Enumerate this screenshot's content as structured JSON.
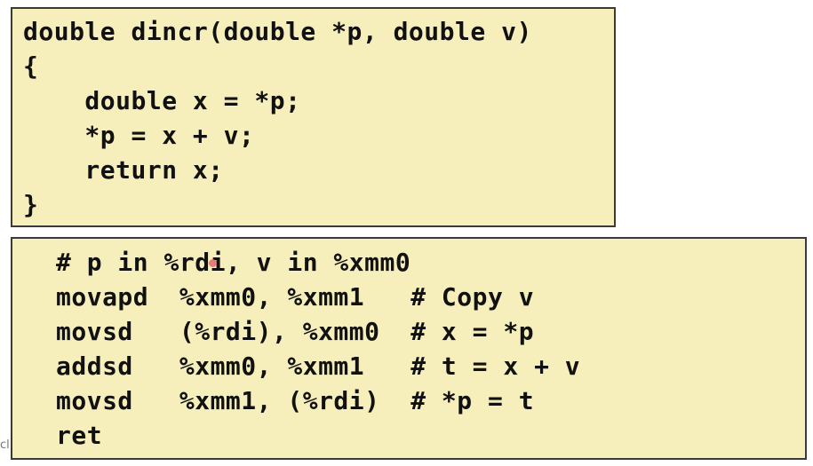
{
  "c_code": {
    "lines": [
      "double dincr(double *p, double v)",
      "{",
      "    double x = *p;",
      "    *p = x + v;",
      "    return x;",
      "}"
    ]
  },
  "assembly": {
    "lines": [
      "# p in %rdi, v in %xmm0",
      "movapd  %xmm0, %xmm1   # Copy v",
      "movsd   (%rdi), %xmm0  # x = *p",
      "addsd   %xmm0, %xmm1   # t = x + v",
      "movsd   %xmm1, (%rdi)  # *p = t",
      "ret"
    ]
  },
  "edge_text": "cl",
  "colors": {
    "box_background": "#f6efbc",
    "box_border": "#3a3a3a",
    "text": "#111111",
    "pointer": "#e4686a"
  }
}
